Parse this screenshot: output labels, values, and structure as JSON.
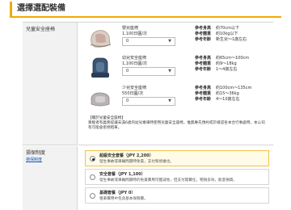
{
  "page": {
    "title": "選擇選配裝備"
  },
  "child_seat": {
    "label": "兒童安全座椅",
    "items": [
      {
        "name": "嬰兒座椅",
        "price": "1,100日圓/次",
        "qty": "0",
        "specs": [
          {
            "k": "參考身高",
            "v": "約70cm以下"
          },
          {
            "k": "參考體重",
            "v": "約10kg以下"
          },
          {
            "k": "參考年齡",
            "v": "新生兒～1歲左右"
          }
        ]
      },
      {
        "name": "幼兒安全座椅",
        "price": "1,100日圓/次",
        "qty": "0",
        "specs": [
          {
            "k": "參考身高",
            "v": "約65cm～100cm"
          },
          {
            "k": "參考體重",
            "v": "約9～18kg"
          },
          {
            "k": "參考年齡",
            "v": "1～4歲左右"
          }
        ]
      },
      {
        "name": "少兒安全座椅",
        "price": "550日圓/次",
        "qty": "0",
        "specs": [
          {
            "k": "參考身高",
            "v": "約100cm～135cm"
          },
          {
            "k": "參考體重",
            "v": "約15～36kg"
          },
          {
            "k": "參考年齡",
            "v": "4～10歲左右"
          }
        ]
      }
    ],
    "note_title": "【關於兒童安全座椅】",
    "note_text": "駕駛者有義務提讓未滿6歲的幼兒乘車時使用兒童安全座椅，惟無專先預約或於確認各本合行事處時，本公司有可能會拒絕租車。"
  },
  "insurance": {
    "label": "損保制度",
    "link": "損保制度",
    "options": [
      {
        "title": "超級安全套餐（JPY 2,200）",
        "desc": "發生事故或車輛問題時免責，支付和修維也。",
        "selected": true
      },
      {
        "title": "安全套餐（JPY 1,100）",
        "desc": "發生事故或車輛問題時的免責費用可獲減免，但支付開費任，物損多效，能意損資。",
        "selected": false
      },
      {
        "title": "基礎套餐（JPY 0）",
        "desc": "租車費用中包含基本保險費。",
        "selected": false
      }
    ]
  },
  "colors": {
    "accent": "#f2a900",
    "selected_bg": "#fffbe6",
    "label_bg": "#f2f2f2"
  },
  "icons": {
    "select_caret": "▼"
  }
}
